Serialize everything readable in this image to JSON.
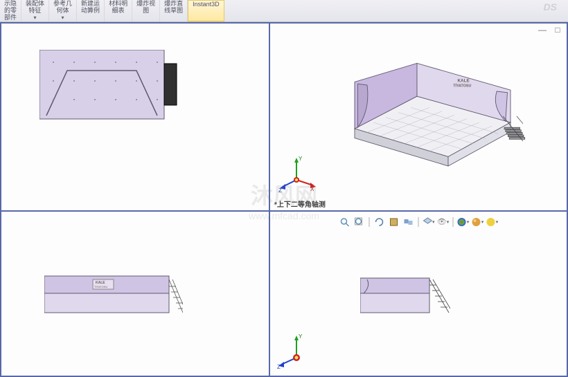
{
  "ribbon": {
    "show_hide": "示隐\n的零\n部件",
    "assembly_feat": "装配体\n特征",
    "ref_geom": "参考几\n何体",
    "new_motion": "新建运\n动算例",
    "bom": "材料明\n细表",
    "exploded": "爆炸视\n图",
    "explode_sketch": "爆炸直\n线草图",
    "instant3d": "Instant3D"
  },
  "viewport": {
    "tr_label": "*上下二等角轴测"
  },
  "triad": {
    "x": "X",
    "y": "Y",
    "z": "Z"
  },
  "model": {
    "sign_line1": "KALE",
    "sign_line2": "TİYATOSU"
  },
  "watermark": {
    "main": "沐风网",
    "sub": "www.mfcad.com"
  },
  "colors": {
    "wall": "#d8d0e8",
    "wall_dark": "#b8a8d0",
    "floor": "#e8e8f0",
    "edge": "#605870"
  }
}
